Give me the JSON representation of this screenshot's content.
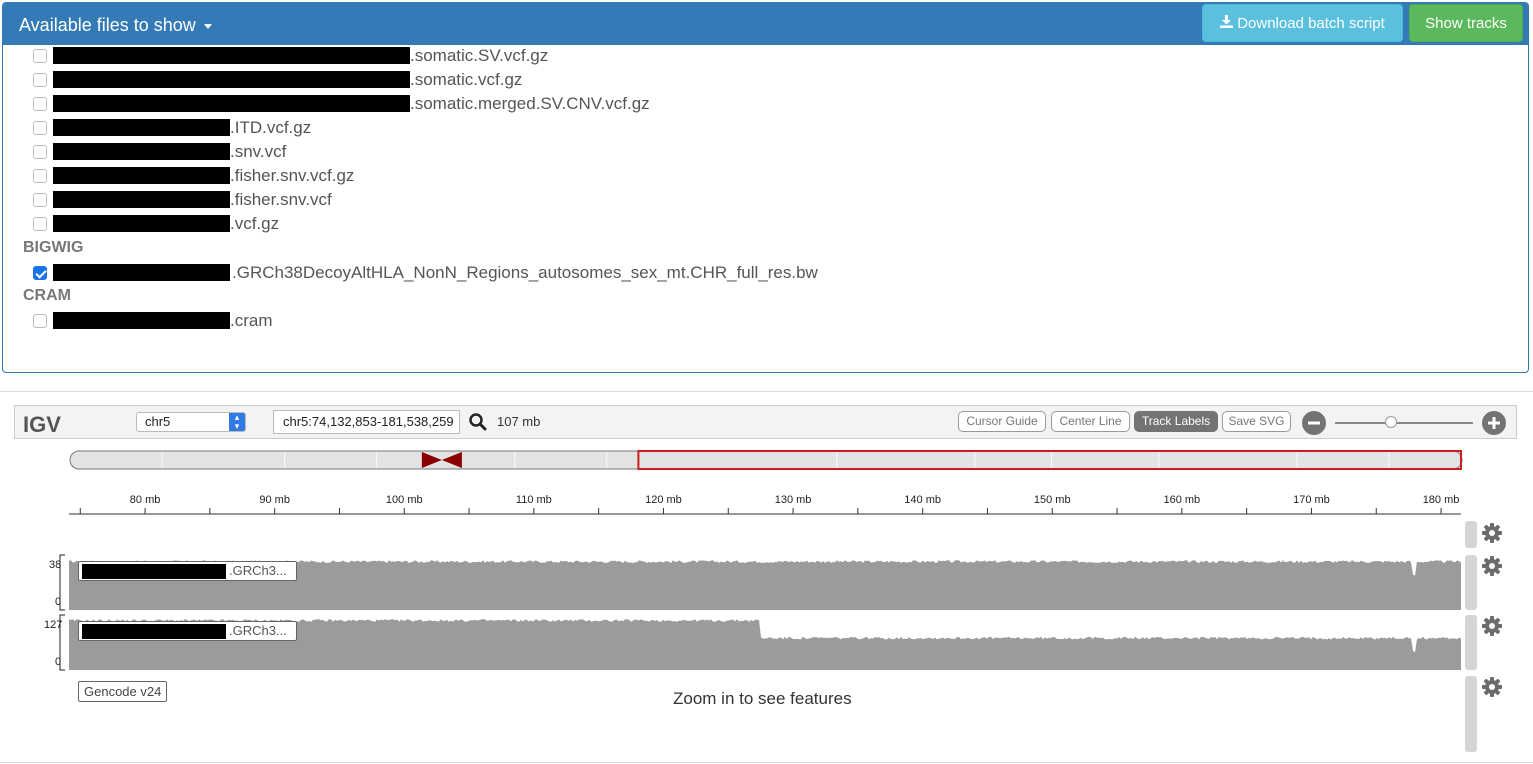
{
  "panel": {
    "title": "Available files to show",
    "download_label": "Download batch script",
    "show_label": "Show tracks"
  },
  "files": [
    {
      "name": ".somatic.SV.vcf.gz",
      "checked": false
    },
    {
      "name": ".somatic.vcf.gz",
      "checked": false
    },
    {
      "name": ".somatic.merged.SV.CNV.vcf.gz",
      "checked": false
    },
    {
      "name": ".ITD.vcf.gz",
      "checked": false
    },
    {
      "name": ".snv.vcf",
      "checked": false
    },
    {
      "name": ".fisher.snv.vcf.gz",
      "checked": false
    },
    {
      "name": ".fisher.snv.vcf",
      "checked": false
    },
    {
      "name": ".vcf.gz",
      "checked": false
    }
  ],
  "sections": {
    "bigwig": {
      "heading": "BIGWIG",
      "file": {
        "name": ".GRCh38DecoyAltHLA_NonN_Regions_autosomes_sex_mt.CHR_full_res.bw",
        "checked": true
      }
    },
    "cram": {
      "heading": "CRAM",
      "file": {
        "name": ".cram",
        "checked": false
      }
    }
  },
  "igv": {
    "logo": "IGV",
    "chromosome": "chr5",
    "locus": "chr5:74,132,853-181,538,259",
    "window_size": "107 mb",
    "buttons": {
      "cursor_guide": "Cursor Guide",
      "center_line": "Center Line",
      "track_labels": "Track Labels",
      "save_svg": "Save SVG"
    },
    "ruler_ticks": [
      "80 mb",
      "90 mb",
      "100 mb",
      "110 mb",
      "120 mb",
      "130 mb",
      "140 mb",
      "150 mb",
      "160 mb",
      "170 mb",
      "180 mb"
    ],
    "ruler_range_mb": [
      74.13,
      181.54
    ],
    "ideogram": {
      "chrom_length_mb": 181.54,
      "centromere_mb": 48.5,
      "view_start_mb": 74.13,
      "view_end_mb": 181.54
    },
    "tracks": [
      {
        "label": ".GRCh3...",
        "axis_max": "38",
        "axis_min": "0",
        "level_fraction": 0.88
      },
      {
        "label": ".GRCh3...",
        "axis_max": "127",
        "axis_min": "0",
        "level_fraction": 0.9,
        "step_drop_at_mb": 127.5,
        "level_after_step": 0.58
      }
    ],
    "gencode": {
      "label": "Gencode v24",
      "message": "Zoom in to see features"
    }
  },
  "colors": {
    "header_blue": "#337ab7",
    "info_button": "#5bc0de",
    "success_button": "#5cb85c",
    "track_fill": "#9b9b9b",
    "ideogram_box": "#cc1f1f",
    "centromere": "#8b0000"
  }
}
